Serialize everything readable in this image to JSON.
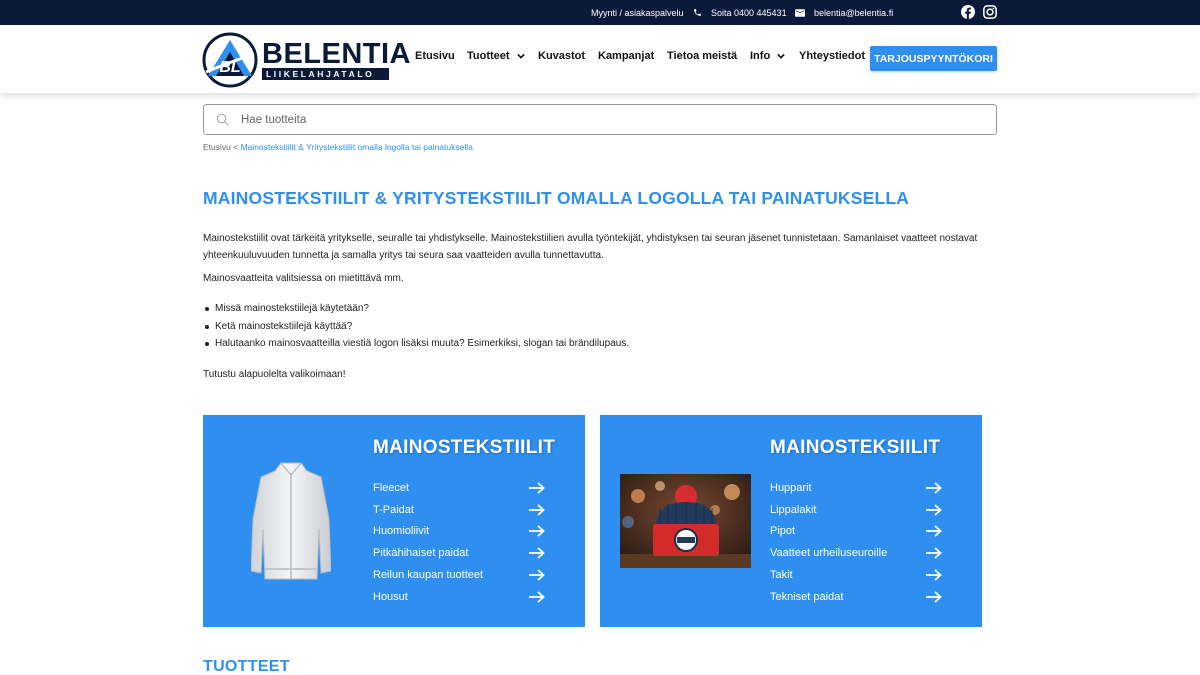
{
  "topbar": {
    "sales_label": "Myynti / asiakaspalvelu",
    "phone_label": "Soita 0400 445431",
    "email_label": "belentia@belentia.fi"
  },
  "header": {
    "logo_name": "BELENTIA",
    "logo_tagline": "LIIKELAHJATALO",
    "logo_monogram": "BL",
    "nav": {
      "home": "Etusivu",
      "products": "Tuotteet",
      "catalogs": "Kuvastot",
      "campaigns": "Kampanjat",
      "about": "Tietoa meistä",
      "info": "Info",
      "contact": "Yhteystiedot"
    },
    "cta_label": "TARJOUSPYYNTÖKORI"
  },
  "search": {
    "placeholder": "Hae tuotteita"
  },
  "breadcrumb": {
    "home": "Etusivu",
    "separator": " < ",
    "current": "Mainostekstiilit & Yritystekstiilit omalla logolla tai painatuksella"
  },
  "page": {
    "title": "MAINOSTEKSTIILIT & YRITYSTEKSTIILIT OMALLA LOGOLLA TAI PAINATUKSELLA",
    "intro": "Mainostekstiilit ovat tärkeitä yritykselle, seuralle tai yhdistykselle. Mainostekstiilien avulla työntekijät, yhdistyksen tai  seuran jäsenet tunnistetaan. Samanlaiset vaatteet nostavat yhteenkuuluvuuden tunnetta ja samalla yritys tai seura saa vaatteiden avulla tunnettavutta.",
    "p2": "Mainosvaatteita valitsiessa on mietittävä mm.",
    "bullets": [
      "Missä mainostekstiilejä käytetään?",
      "Ketä mainostekstiilejä käyttää?",
      "Halutaanko mainosvaatteilla viestiä logon lisäksi muuta? Esimerkiksi, slogan tai brändilupaus."
    ],
    "p3": "Tutustu alapuolelta valikoimaan!"
  },
  "cards": [
    {
      "title": "MAINOSTEKSTIILIT",
      "image": "white-fleece-jacket",
      "items": [
        "Fleecet",
        "T-Paidat",
        "Huomioliivit",
        "Pitkähihaiset paidat",
        "Reilun kaupan tuotteet",
        "Housut"
      ]
    },
    {
      "title": "MAINOSTEKSIILIT",
      "image": "knit-beanie-with-logo",
      "items": [
        "Hupparit",
        "Lippalakit",
        "Pipot",
        "Vaatteet urheiluseuroille",
        "Takit",
        "Tekniset paidat"
      ]
    }
  ],
  "section_title": "TUOTTEET",
  "icons": {
    "phone": "phone-icon",
    "email": "email-icon",
    "facebook": "facebook-icon",
    "instagram": "instagram-icon",
    "search": "search-icon",
    "chevron": "chevron-down-icon",
    "arrow": "arrow-right-icon"
  },
  "colors": {
    "navy": "#0c1a3a",
    "accent": "#2f8ff0"
  }
}
